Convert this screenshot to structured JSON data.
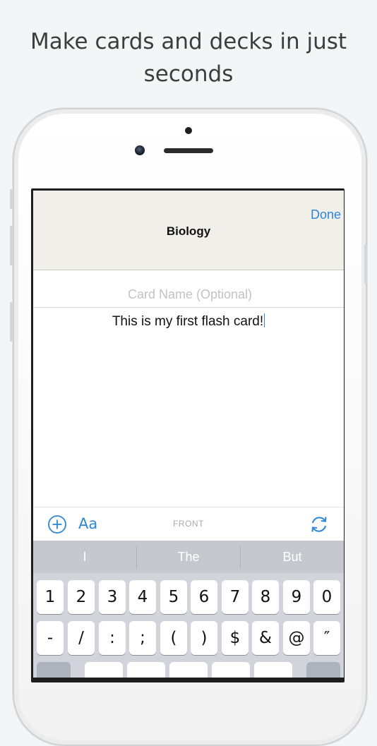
{
  "headline": "Make cards and decks in just seconds",
  "nav": {
    "title": "Biology",
    "done_label": "Done"
  },
  "editor": {
    "card_name_placeholder": "Card Name (Optional)",
    "card_name_value": "",
    "body_text": "This is my first flash card!"
  },
  "toolbar": {
    "font_label": "Aa",
    "side_label": "FRONT"
  },
  "keyboard": {
    "suggestions": [
      "I",
      "The",
      "But"
    ],
    "row1": [
      "1",
      "2",
      "3",
      "4",
      "5",
      "6",
      "7",
      "8",
      "9",
      "0"
    ],
    "row2": [
      "-",
      "/",
      ":",
      ";",
      "(",
      ")",
      "$",
      "&",
      "@",
      "″"
    ]
  },
  "colors": {
    "accent": "#2e86d6",
    "nav_bg": "#f0efea",
    "keyboard_bg": "#d1d5db"
  },
  "icons": {
    "add": "plus-circle-icon",
    "flip": "refresh-icon"
  }
}
